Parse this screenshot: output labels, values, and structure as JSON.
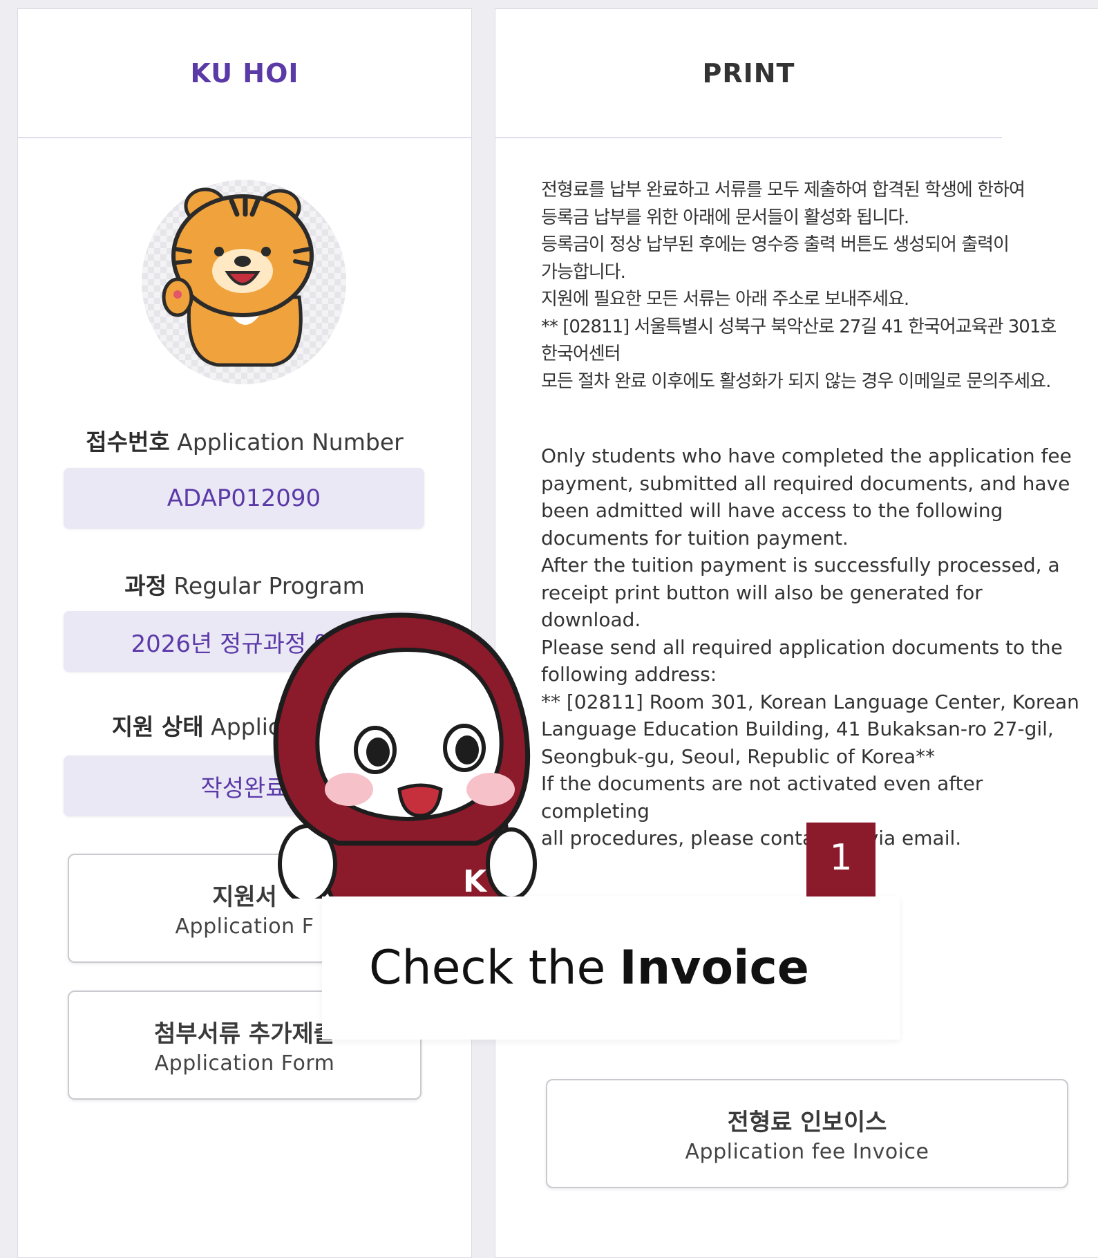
{
  "left_panel": {
    "title": "KU HOI",
    "application_number": {
      "label_ko": "접수번호",
      "label_en": "Application Number",
      "value": "ADAP012090"
    },
    "program": {
      "label_ko": "과정",
      "label_en": "Regular Program",
      "value": "2026년 정규과정 여름"
    },
    "status": {
      "label_ko": "지원 상태",
      "label_en": "Applica",
      "value": "작성완료"
    },
    "buttons": [
      {
        "ko": "지원서",
        "en": "Application F"
      },
      {
        "ko": "첨부서류 추가제출",
        "en": "Application Form"
      }
    ]
  },
  "right_panel": {
    "title": "PRINT",
    "notice_ko": [
      "전형료를 납부 완료하고 서류를 모두 제출하여 합격된 학생에 한하여",
      "등록금 납부를 위한 아래에 문서들이 활성화 됩니다.",
      "등록금이 정상 납부된 후에는 영수증 출력 버튼도 생성되어 출력이",
      "가능합니다.",
      "지원에 필요한 모든 서류는 아래 주소로 보내주세요.",
      "** [02811] 서울특별시 성북구 북악산로 27길 41 한국어교육관 301호",
      "한국어센터",
      "모든 절차 완료 이후에도 활성화가 되지 않는 경우 이메일로 문의주세요."
    ],
    "notice_en": [
      "Only students who have completed the application fee",
      "payment, submitted all required documents, and have",
      "been admitted will have access to the following",
      "documents for tuition payment.",
      "After the tuition payment is successfully processed, a",
      "receipt print button will also be generated for download.",
      "Please send all required application documents to the",
      "following address:",
      "** [02811] Room 301, Korean Language Center, Korean",
      "Language Education Building, 41 Bukaksan-ro 27-gil,",
      "Seongbuk-gu, Seoul, Republic of Korea**",
      "If the documents are not activated even after completing",
      "all procedures, please contact us via email."
    ],
    "invoice_button": {
      "ko": "전형료 인보이스",
      "en": "Application fee Invoice"
    }
  },
  "tutorial": {
    "step_number": "1",
    "instruction_prefix": "Check the",
    "instruction_bold": "Invoice",
    "mascot_letter": "K"
  },
  "colors": {
    "accent_purple": "#5b3aa8",
    "value_bg": "#ebe8f5",
    "crimson": "#8b1a2b",
    "tiger_orange": "#f0a23c"
  }
}
